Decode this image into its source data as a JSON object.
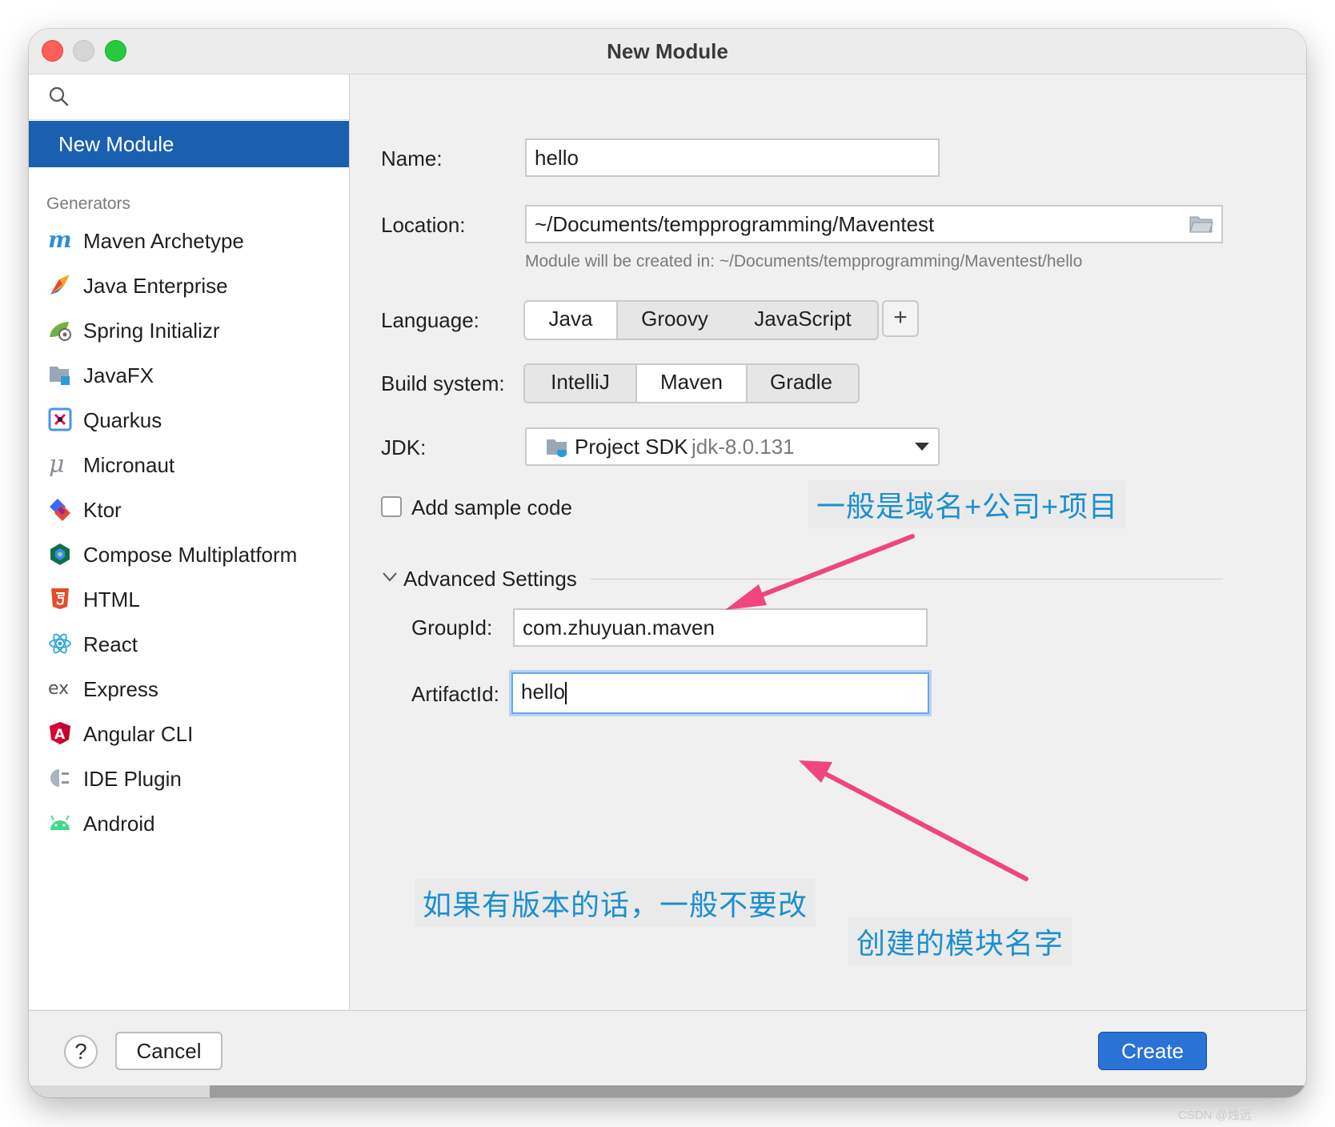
{
  "window": {
    "title": "New Module"
  },
  "sidebar": {
    "selected_item": "New Module",
    "section_title": "Generators",
    "generators": [
      {
        "label": "Maven Archetype",
        "icon": "maven-icon"
      },
      {
        "label": "Java Enterprise",
        "icon": "java-enterprise-icon"
      },
      {
        "label": "Spring Initializr",
        "icon": "spring-icon"
      },
      {
        "label": "JavaFX",
        "icon": "javafx-icon"
      },
      {
        "label": "Quarkus",
        "icon": "quarkus-icon"
      },
      {
        "label": "Micronaut",
        "icon": "micronaut-icon"
      },
      {
        "label": "Ktor",
        "icon": "ktor-icon"
      },
      {
        "label": "Compose Multiplatform",
        "icon": "compose-icon"
      },
      {
        "label": "HTML",
        "icon": "html5-icon"
      },
      {
        "label": "React",
        "icon": "react-icon"
      },
      {
        "label": "Express",
        "icon": "express-icon"
      },
      {
        "label": "Angular CLI",
        "icon": "angular-icon"
      },
      {
        "label": "IDE Plugin",
        "icon": "plugin-icon"
      },
      {
        "label": "Android",
        "icon": "android-icon"
      }
    ]
  },
  "form": {
    "name_label": "Name:",
    "name_value": "hello",
    "location_label": "Location:",
    "location_value": "~/Documents/tempprogramming/Maventest",
    "location_hint": "Module will be created in: ~/Documents/tempprogramming/Maventest/hello",
    "language_label": "Language:",
    "languages": [
      "Java",
      "Groovy",
      "JavaScript"
    ],
    "language_selected": "Java",
    "add_language": "+",
    "build_label": "Build system:",
    "build_systems": [
      "IntelliJ",
      "Maven",
      "Gradle"
    ],
    "build_selected": "Maven",
    "jdk_label": "JDK:",
    "jdk_name": "Project SDK",
    "jdk_version": "jdk-8.0.131",
    "sample_code_label": "Add sample code",
    "sample_code_checked": false,
    "advanced_title": "Advanced Settings",
    "groupid_label": "GroupId:",
    "groupid_value": "com.zhuyuan.maven",
    "artifactid_label": "ArtifactId:",
    "artifactid_value": "hello"
  },
  "buttons": {
    "help": "?",
    "cancel": "Cancel",
    "create": "Create"
  },
  "annotations": {
    "groupid_note": "一般是域名+公司+项目",
    "version_note": "如果有版本的话，一般不要改",
    "artifactid_note": "创建的模块名字",
    "arrow_color": "#f0457e",
    "text_color": "#1b8fcf"
  },
  "colors": {
    "accent": "#1b5fb0",
    "create_button": "#2a72d6"
  },
  "watermark": "CSDN @烛远"
}
